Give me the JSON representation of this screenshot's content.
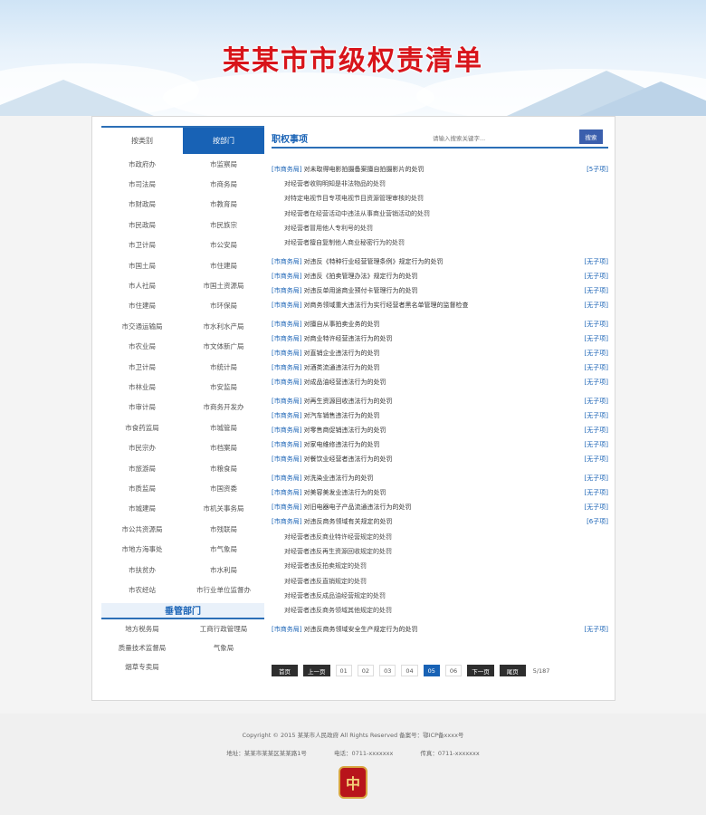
{
  "banner": {
    "title": "某某市市级权责清单"
  },
  "left": {
    "tabs": [
      {
        "label": "按类别"
      },
      {
        "label": "按部门"
      }
    ],
    "departments": [
      "市政府办",
      "市监察局",
      "市司法局",
      "市商务局",
      "市财政局",
      "市教育局",
      "市民政局",
      "市民族宗",
      "市卫计局",
      "市公安局",
      "市国土局",
      "市住建局",
      "市人社局",
      "市国土资源局",
      "市住建局",
      "市环保局",
      "市交通运输局",
      "市水利水产局",
      "市农业局",
      "市文体新广局",
      "市卫计局",
      "市统计局",
      "市林业局",
      "市安监局",
      "市审计局",
      "市商务开发办",
      "市食药监局",
      "市城管局",
      "市民宗办",
      "市档案局",
      "市旅游局",
      "市粮食局",
      "市质监局",
      "市国资委",
      "市城建局",
      "市机关事务局",
      "市公共资源局",
      "市残联局",
      "市地方海事处",
      "市气象局",
      "市扶贫办",
      "市水利局",
      "市农经站",
      "市行业单位监督办"
    ],
    "supervision_title": "垂管部门",
    "supervision": [
      "地方税务局",
      "工商行政管理局",
      "质量技术监督局",
      "气象局",
      "烟草专卖局"
    ]
  },
  "right": {
    "title": "职权事项",
    "search_placeholder": "请输入搜索关键字...",
    "search_button": "搜索",
    "groups": [
      {
        "rows": [
          {
            "tag": "[市商务局]",
            "text": "对未取得电影拍摄备案擅自拍摄影片的处罚",
            "count": "[5子项]"
          }
        ],
        "subs": [
          "对经营者收购明知是非法物品的处罚",
          "对特定电视节目专项电视节目资源管理审核的处罚",
          "对经营者在经营活动中违法从事商业营销活动的处罚",
          "对经营者冒用他人专利号的处罚",
          "对经营者擅自复制他人商业秘密行为的处罚"
        ]
      },
      {
        "rows": [
          {
            "tag": "[市商务局]",
            "text": "对违反《特种行业经营管理条例》规定行为的处罚",
            "count": "[无子项]"
          },
          {
            "tag": "[市商务局]",
            "text": "对违反《拍卖管理办法》规定行为的处罚",
            "count": "[无子项]"
          },
          {
            "tag": "[市商务局]",
            "text": "对违反单用途商业预付卡管理行为的处罚",
            "count": "[无子项]"
          },
          {
            "tag": "[市商务局]",
            "text": "对商务领域重大违法行为实行经营者黑名单管理的监督检查",
            "count": "[无子项]"
          }
        ]
      },
      {
        "rows": [
          {
            "tag": "[市商务局]",
            "text": "对擅自从事拍卖业务的处罚",
            "count": "[无子项]"
          },
          {
            "tag": "[市商务局]",
            "text": "对商业特许经营违法行为的处罚",
            "count": "[无子项]"
          },
          {
            "tag": "[市商务局]",
            "text": "对直销企业违法行为的处罚",
            "count": "[无子项]"
          },
          {
            "tag": "[市商务局]",
            "text": "对酒类流通违法行为的处罚",
            "count": "[无子项]"
          },
          {
            "tag": "[市商务局]",
            "text": "对成品油经营违法行为的处罚",
            "count": "[无子项]"
          }
        ]
      },
      {
        "rows": [
          {
            "tag": "[市商务局]",
            "text": "对再生资源回收违法行为的处罚",
            "count": "[无子项]"
          },
          {
            "tag": "[市商务局]",
            "text": "对汽车销售违法行为的处罚",
            "count": "[无子项]"
          },
          {
            "tag": "[市商务局]",
            "text": "对零售商促销违法行为的处罚",
            "count": "[无子项]"
          },
          {
            "tag": "[市商务局]",
            "text": "对家电维修违法行为的处罚",
            "count": "[无子项]"
          },
          {
            "tag": "[市商务局]",
            "text": "对餐饮业经营者违法行为的处罚",
            "count": "[无子项]"
          }
        ]
      },
      {
        "rows": [
          {
            "tag": "[市商务局]",
            "text": "对洗染业违法行为的处罚",
            "count": "[无子项]"
          },
          {
            "tag": "[市商务局]",
            "text": "对美容美发业违法行为的处罚",
            "count": "[无子项]"
          },
          {
            "tag": "[市商务局]",
            "text": "对旧电器电子产品流通违法行为的处罚",
            "count": "[无子项]"
          },
          {
            "tag": "[市商务局]",
            "text": "对违反商务领域有关规定的处罚",
            "count": "[6子项]"
          }
        ],
        "subs": [
          "对经营者违反商业特许经营规定的处罚",
          "对经营者违反再生资源回收规定的处罚",
          "对经营者违反拍卖规定的处罚",
          "对经营者违反直销规定的处罚",
          "对经营者违反成品油经营规定的处罚",
          "对经营者违反商务领域其他规定的处罚"
        ]
      },
      {
        "rows": [
          {
            "tag": "[市商务局]",
            "text": "对违反商务领域安全生产规定行为的处罚",
            "count": "[无子项]"
          }
        ]
      }
    ],
    "pager": {
      "first": "首页",
      "prev": "上一页",
      "pages": [
        "01",
        "02",
        "03",
        "04",
        "05",
        "06"
      ],
      "current": "05",
      "next": "下一页",
      "last": "尾页",
      "info": "5/187"
    }
  },
  "footer": {
    "line1": "Copyright © 2015 某某市人民政府 All Rights Reserved 备案号：鄂ICP备xxxx号",
    "address": "地址：某某市某某区某某路1号",
    "phone": "电话：0711-xxxxxxx",
    "fax": "传真：0711-xxxxxxx",
    "emblem": "中"
  }
}
